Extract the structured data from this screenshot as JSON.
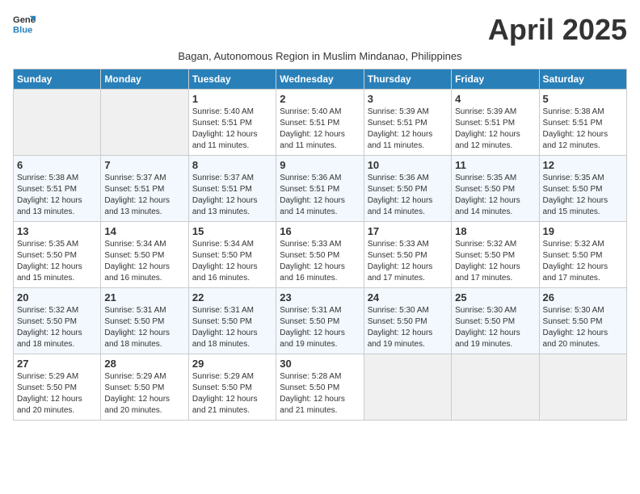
{
  "logo": {
    "line1": "General",
    "line2": "Blue"
  },
  "title": "April 2025",
  "subtitle": "Bagan, Autonomous Region in Muslim Mindanao, Philippines",
  "headers": [
    "Sunday",
    "Monday",
    "Tuesday",
    "Wednesday",
    "Thursday",
    "Friday",
    "Saturday"
  ],
  "weeks": [
    [
      {
        "day": "",
        "info": ""
      },
      {
        "day": "",
        "info": ""
      },
      {
        "day": "1",
        "info": "Sunrise: 5:40 AM\nSunset: 5:51 PM\nDaylight: 12 hours and 11 minutes."
      },
      {
        "day": "2",
        "info": "Sunrise: 5:40 AM\nSunset: 5:51 PM\nDaylight: 12 hours and 11 minutes."
      },
      {
        "day": "3",
        "info": "Sunrise: 5:39 AM\nSunset: 5:51 PM\nDaylight: 12 hours and 11 minutes."
      },
      {
        "day": "4",
        "info": "Sunrise: 5:39 AM\nSunset: 5:51 PM\nDaylight: 12 hours and 12 minutes."
      },
      {
        "day": "5",
        "info": "Sunrise: 5:38 AM\nSunset: 5:51 PM\nDaylight: 12 hours and 12 minutes."
      }
    ],
    [
      {
        "day": "6",
        "info": "Sunrise: 5:38 AM\nSunset: 5:51 PM\nDaylight: 12 hours and 13 minutes."
      },
      {
        "day": "7",
        "info": "Sunrise: 5:37 AM\nSunset: 5:51 PM\nDaylight: 12 hours and 13 minutes."
      },
      {
        "day": "8",
        "info": "Sunrise: 5:37 AM\nSunset: 5:51 PM\nDaylight: 12 hours and 13 minutes."
      },
      {
        "day": "9",
        "info": "Sunrise: 5:36 AM\nSunset: 5:51 PM\nDaylight: 12 hours and 14 minutes."
      },
      {
        "day": "10",
        "info": "Sunrise: 5:36 AM\nSunset: 5:50 PM\nDaylight: 12 hours and 14 minutes."
      },
      {
        "day": "11",
        "info": "Sunrise: 5:35 AM\nSunset: 5:50 PM\nDaylight: 12 hours and 14 minutes."
      },
      {
        "day": "12",
        "info": "Sunrise: 5:35 AM\nSunset: 5:50 PM\nDaylight: 12 hours and 15 minutes."
      }
    ],
    [
      {
        "day": "13",
        "info": "Sunrise: 5:35 AM\nSunset: 5:50 PM\nDaylight: 12 hours and 15 minutes."
      },
      {
        "day": "14",
        "info": "Sunrise: 5:34 AM\nSunset: 5:50 PM\nDaylight: 12 hours and 16 minutes."
      },
      {
        "day": "15",
        "info": "Sunrise: 5:34 AM\nSunset: 5:50 PM\nDaylight: 12 hours and 16 minutes."
      },
      {
        "day": "16",
        "info": "Sunrise: 5:33 AM\nSunset: 5:50 PM\nDaylight: 12 hours and 16 minutes."
      },
      {
        "day": "17",
        "info": "Sunrise: 5:33 AM\nSunset: 5:50 PM\nDaylight: 12 hours and 17 minutes."
      },
      {
        "day": "18",
        "info": "Sunrise: 5:32 AM\nSunset: 5:50 PM\nDaylight: 12 hours and 17 minutes."
      },
      {
        "day": "19",
        "info": "Sunrise: 5:32 AM\nSunset: 5:50 PM\nDaylight: 12 hours and 17 minutes."
      }
    ],
    [
      {
        "day": "20",
        "info": "Sunrise: 5:32 AM\nSunset: 5:50 PM\nDaylight: 12 hours and 18 minutes."
      },
      {
        "day": "21",
        "info": "Sunrise: 5:31 AM\nSunset: 5:50 PM\nDaylight: 12 hours and 18 minutes."
      },
      {
        "day": "22",
        "info": "Sunrise: 5:31 AM\nSunset: 5:50 PM\nDaylight: 12 hours and 18 minutes."
      },
      {
        "day": "23",
        "info": "Sunrise: 5:31 AM\nSunset: 5:50 PM\nDaylight: 12 hours and 19 minutes."
      },
      {
        "day": "24",
        "info": "Sunrise: 5:30 AM\nSunset: 5:50 PM\nDaylight: 12 hours and 19 minutes."
      },
      {
        "day": "25",
        "info": "Sunrise: 5:30 AM\nSunset: 5:50 PM\nDaylight: 12 hours and 19 minutes."
      },
      {
        "day": "26",
        "info": "Sunrise: 5:30 AM\nSunset: 5:50 PM\nDaylight: 12 hours and 20 minutes."
      }
    ],
    [
      {
        "day": "27",
        "info": "Sunrise: 5:29 AM\nSunset: 5:50 PM\nDaylight: 12 hours and 20 minutes."
      },
      {
        "day": "28",
        "info": "Sunrise: 5:29 AM\nSunset: 5:50 PM\nDaylight: 12 hours and 20 minutes."
      },
      {
        "day": "29",
        "info": "Sunrise: 5:29 AM\nSunset: 5:50 PM\nDaylight: 12 hours and 21 minutes."
      },
      {
        "day": "30",
        "info": "Sunrise: 5:28 AM\nSunset: 5:50 PM\nDaylight: 12 hours and 21 minutes."
      },
      {
        "day": "",
        "info": ""
      },
      {
        "day": "",
        "info": ""
      },
      {
        "day": "",
        "info": ""
      }
    ]
  ]
}
